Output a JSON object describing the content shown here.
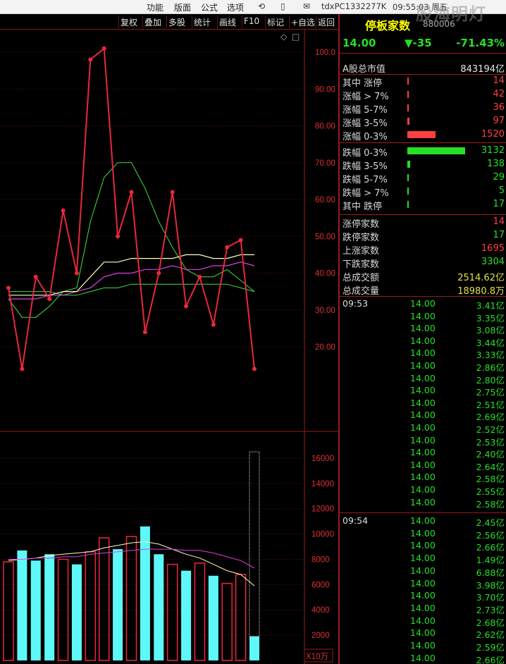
{
  "titlebar": {
    "menus": [
      "功能",
      "版面",
      "公式",
      "选项"
    ],
    "pc_name": "tdxPC1332277K",
    "time": "09:55:03 周五",
    "watermark": "股海明灯"
  },
  "toolbar": [
    "复权",
    "叠加",
    "多股",
    "统计",
    "画线",
    "F10",
    "标记",
    "+自选",
    "返回"
  ],
  "chart": {
    "y_ticks": [
      "100.0",
      "90.00",
      "80.00",
      "70.00",
      "60.00",
      "50.00",
      "40.00",
      "30.00",
      "20.00"
    ],
    "vol_ticks": [
      "16000",
      "14000",
      "12000",
      "10000",
      "8000",
      "6000",
      "4000",
      "2000"
    ],
    "vol_unit": "X10万",
    "colors": {
      "price": "#e8283c",
      "ma_yellow": "#ffffc0",
      "ma_magenta": "#e040e0",
      "ma_green": "#40e040",
      "vol_up": "#e8283c",
      "vol_down": "#5ff8f8"
    }
  },
  "chart_data": {
    "type": "line",
    "price": [
      36,
      14,
      39,
      33,
      57,
      40,
      98,
      101,
      50,
      62,
      24,
      40,
      62,
      31,
      39,
      26,
      47,
      49,
      14
    ],
    "ma_yellow": [
      34,
      34,
      34,
      34,
      35,
      35,
      39,
      43,
      43,
      44,
      44,
      44,
      44,
      45,
      45,
      44,
      44,
      45,
      45
    ],
    "ma_magenta": [
      33,
      33,
      33,
      34,
      34,
      35,
      36,
      39,
      40,
      40,
      41,
      41,
      42,
      41,
      41,
      42,
      42,
      43,
      42
    ],
    "ma_green1": [
      33,
      28,
      28,
      31,
      35,
      36,
      54,
      66,
      70,
      70,
      63,
      54,
      47,
      41,
      39,
      39,
      41,
      38,
      35
    ],
    "ma_green2": [
      35,
      35,
      35,
      35,
      34,
      34,
      35,
      36,
      36,
      37,
      37,
      37,
      37,
      37,
      37,
      37,
      37,
      36,
      35
    ],
    "volume": [
      7800,
      8700,
      7900,
      8400,
      8000,
      7600,
      8600,
      9700,
      8800,
      9800,
      10600,
      8400,
      7600,
      7100,
      7700,
      6700,
      6100,
      6800,
      1900
    ],
    "volume_up": [
      true,
      false,
      false,
      false,
      true,
      false,
      true,
      true,
      false,
      true,
      false,
      false,
      true,
      false,
      true,
      false,
      true,
      true,
      false
    ],
    "vol_ma1": [
      7900,
      8000,
      8100,
      8300,
      8400,
      8500,
      8600,
      8900,
      9100,
      9300,
      9400,
      9200,
      8800,
      8400,
      8100,
      7600,
      7100,
      6800,
      5900
    ],
    "vol_ma2": [
      8000,
      8000,
      8100,
      8100,
      8200,
      8200,
      8400,
      8500,
      8600,
      8700,
      8800,
      8800,
      8800,
      8700,
      8700,
      8500,
      8200,
      7900,
      7300
    ],
    "ylim": [
      0,
      106
    ],
    "vol_ylim": [
      0,
      17000
    ]
  },
  "side": {
    "name": "停板家数",
    "code": "880006",
    "price": "14.00",
    "change": "▼-35",
    "change_pct": "-71.43%",
    "mktcap_label": "A股总市值",
    "mktcap_value": "843194亿",
    "dist": [
      {
        "label": "其中 涨停",
        "value": "14",
        "color": "#ff4040",
        "bar": 0.005
      },
      {
        "label": "涨幅 > 7%",
        "value": "42",
        "color": "#ff4040",
        "bar": 0.01
      },
      {
        "label": "涨幅 5-7%",
        "value": "36",
        "color": "#ff4040",
        "bar": 0.01
      },
      {
        "label": "涨幅 3-5%",
        "value": "97",
        "color": "#ff4040",
        "bar": 0.04
      },
      {
        "label": "涨幅 0-3%",
        "value": "1520",
        "color": "#ff4040",
        "bar": 0.49
      },
      {
        "label": "跌幅 0-3%",
        "value": "3132",
        "color": "#25e025",
        "bar": 1.0
      },
      {
        "label": "跌幅 3-5%",
        "value": "138",
        "color": "#25e025",
        "bar": 0.05
      },
      {
        "label": "跌幅 5-7%",
        "value": "29",
        "color": "#25e025",
        "bar": 0.01
      },
      {
        "label": "跌幅 > 7%",
        "value": "5",
        "color": "#25e025",
        "bar": 0.005
      },
      {
        "label": "其中 跌停",
        "value": "17",
        "color": "#25e025",
        "bar": 0.005
      }
    ],
    "stats": [
      {
        "label": "涨停家数",
        "value": "14",
        "color": "#ff4040"
      },
      {
        "label": "跌停家数",
        "value": "17",
        "color": "#25e025"
      },
      {
        "label": "上涨家数",
        "value": "1695",
        "color": "#ff4040"
      },
      {
        "label": "下跌家数",
        "value": "3304",
        "color": "#25e025"
      },
      {
        "label": "总成交额",
        "value": "2514.62亿",
        "color": "#e0e040"
      },
      {
        "label": "总成交量",
        "value": "18980.8万",
        "color": "#e0e040"
      }
    ],
    "ticks": [
      {
        "time": "09:53",
        "price": "14.00",
        "amt": "3.41亿"
      },
      {
        "time": "",
        "price": "14.00",
        "amt": "3.35亿"
      },
      {
        "time": "",
        "price": "14.00",
        "amt": "3.08亿"
      },
      {
        "time": "",
        "price": "14.00",
        "amt": "3.44亿"
      },
      {
        "time": "",
        "price": "14.00",
        "amt": "3.33亿"
      },
      {
        "time": "",
        "price": "14.00",
        "amt": "2.86亿"
      },
      {
        "time": "",
        "price": "14.00",
        "amt": "2.80亿"
      },
      {
        "time": "",
        "price": "14.00",
        "amt": "2.75亿"
      },
      {
        "time": "",
        "price": "14.00",
        "amt": "2.51亿"
      },
      {
        "time": "",
        "price": "14.00",
        "amt": "2.69亿"
      },
      {
        "time": "",
        "price": "14.00",
        "amt": "2.52亿"
      },
      {
        "time": "",
        "price": "14.00",
        "amt": "2.53亿"
      },
      {
        "time": "",
        "price": "14.00",
        "amt": "2.40亿"
      },
      {
        "time": "",
        "price": "14.00",
        "amt": "2.64亿"
      },
      {
        "time": "",
        "price": "14.00",
        "amt": "2.58亿"
      },
      {
        "time": "",
        "price": "14.00",
        "amt": "2.55亿"
      },
      {
        "time": "",
        "price": "14.00",
        "amt": "2.58亿"
      },
      {
        "time": "09:54",
        "price": "14.00",
        "amt": "2.45亿"
      },
      {
        "time": "",
        "price": "14.00",
        "amt": "2.56亿"
      },
      {
        "time": "",
        "price": "14.00",
        "amt": "2.66亿"
      },
      {
        "time": "",
        "price": "14.00",
        "amt": "1.49亿"
      },
      {
        "time": "",
        "price": "14.00",
        "amt": "6.88亿"
      },
      {
        "time": "",
        "price": "14.00",
        "amt": "3.98亿"
      },
      {
        "time": "",
        "price": "14.00",
        "amt": "3.70亿"
      },
      {
        "time": "",
        "price": "14.00",
        "amt": "2.73亿"
      },
      {
        "time": "",
        "price": "14.00",
        "amt": "2.68亿"
      },
      {
        "time": "",
        "price": "14.00",
        "amt": "2.62亿"
      },
      {
        "time": "",
        "price": "14.00",
        "amt": "2.59亿"
      },
      {
        "time": "",
        "price": "14.00",
        "amt": "2.66亿"
      }
    ]
  }
}
